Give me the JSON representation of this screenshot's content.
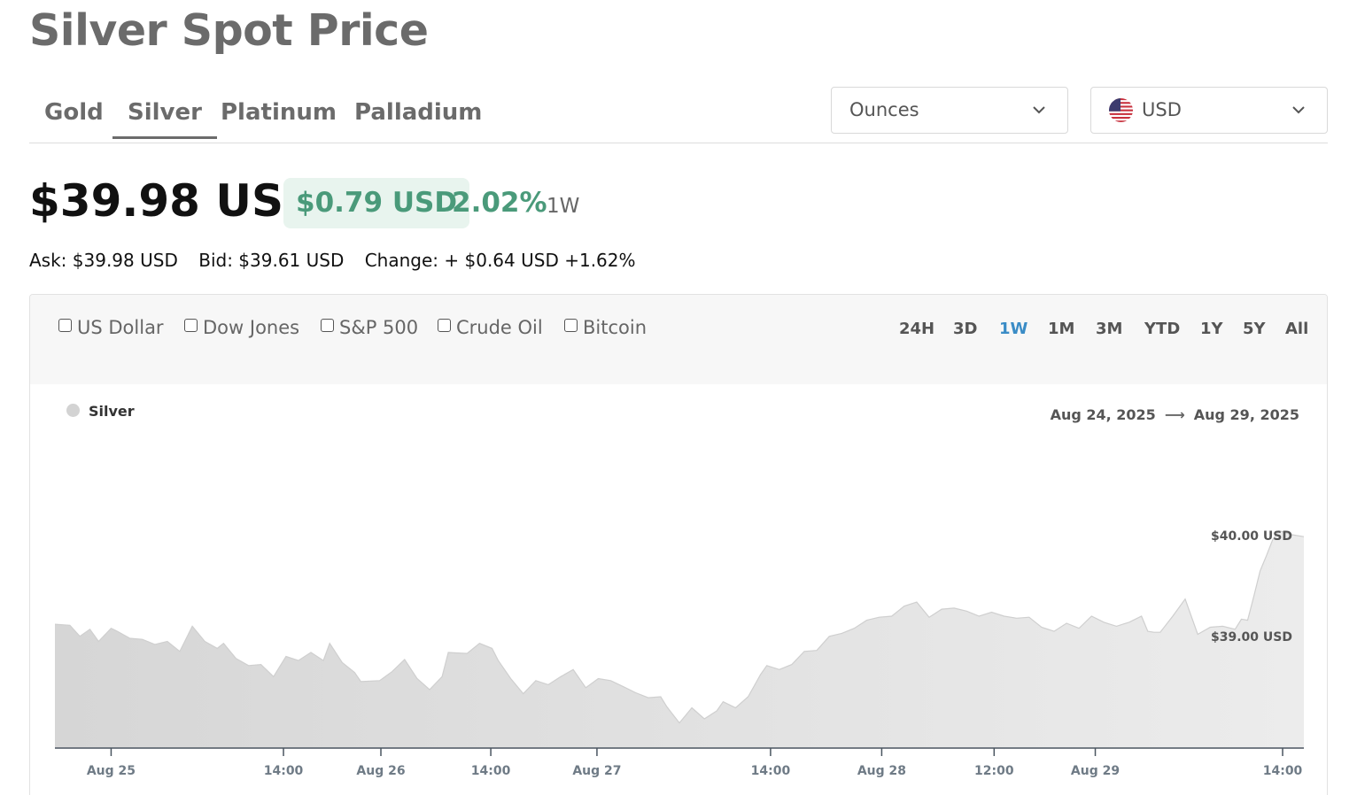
{
  "page_title": "Silver Spot Price",
  "metal_tabs": [
    {
      "label": "Gold",
      "active": false
    },
    {
      "label": "Silver",
      "active": true
    },
    {
      "label": "Platinum",
      "active": false
    },
    {
      "label": "Palladium",
      "active": false
    }
  ],
  "units_select": {
    "value": "Ounces",
    "icon": "chevron-down-icon"
  },
  "currency_select": {
    "value": "USD",
    "icon": "us-flag-icon"
  },
  "price": {
    "current": "$39.98 USD",
    "change": "$0.79 USD",
    "change_pct": "2.02%",
    "period": "1W",
    "change_color": "#4a9a7a"
  },
  "quote": {
    "ask": "Ask: $39.98 USD",
    "bid": "Bid: $39.61 USD",
    "change": "Change: + $0.64 USD +1.62%"
  },
  "compare_options": [
    "US Dollar",
    "Dow Jones",
    "S&P 500",
    "Crude Oil",
    "Bitcoin"
  ],
  "time_ranges": [
    {
      "label": "24H",
      "active": false
    },
    {
      "label": "3D",
      "active": false
    },
    {
      "label": "1W",
      "active": true
    },
    {
      "label": "1M",
      "active": false
    },
    {
      "label": "3M",
      "active": false
    },
    {
      "label": "YTD",
      "active": false
    },
    {
      "label": "1Y",
      "active": false
    },
    {
      "label": "5Y",
      "active": false
    },
    {
      "label": "All",
      "active": false
    }
  ],
  "accent_color": "#3a8cc6",
  "chart_data": {
    "type": "area",
    "legend": "Silver",
    "date_from": "Aug 24, 2025",
    "date_to": "Aug 29, 2025",
    "y_labels": [
      {
        "value": 40.0,
        "label": "$40.00 USD"
      },
      {
        "value": 39.0,
        "label": "$39.00 USD"
      }
    ],
    "x_ticks": [
      {
        "t": 0.045,
        "label": "Aug 25"
      },
      {
        "t": 0.183,
        "label": "14:00"
      },
      {
        "t": 0.261,
        "label": "Aug 26"
      },
      {
        "t": 0.349,
        "label": "14:00"
      },
      {
        "t": 0.434,
        "label": "Aug 27"
      },
      {
        "t": 0.573,
        "label": "14:00"
      },
      {
        "t": 0.662,
        "label": "Aug 28"
      },
      {
        "t": 0.752,
        "label": "12:00"
      },
      {
        "t": 0.833,
        "label": "Aug 29"
      },
      {
        "t": 0.983,
        "label": "14:00"
      }
    ],
    "ylim": [
      37.89,
      40.15
    ],
    "series": [
      {
        "name": "Silver",
        "t": [
          0.0,
          0.012,
          0.02,
          0.028,
          0.035,
          0.045,
          0.05,
          0.06,
          0.07,
          0.08,
          0.09,
          0.1,
          0.11,
          0.12,
          0.13,
          0.135,
          0.145,
          0.155,
          0.165,
          0.175,
          0.185,
          0.195,
          0.205,
          0.215,
          0.22,
          0.23,
          0.24,
          0.245,
          0.26,
          0.27,
          0.28,
          0.29,
          0.3,
          0.31,
          0.315,
          0.33,
          0.34,
          0.35,
          0.355,
          0.365,
          0.375,
          0.385,
          0.395,
          0.405,
          0.415,
          0.425,
          0.435,
          0.445,
          0.455,
          0.465,
          0.475,
          0.485,
          0.49,
          0.5,
          0.51,
          0.52,
          0.53,
          0.535,
          0.545,
          0.555,
          0.565,
          0.57,
          0.58,
          0.59,
          0.6,
          0.61,
          0.62,
          0.63,
          0.64,
          0.65,
          0.66,
          0.67,
          0.68,
          0.69,
          0.7,
          0.71,
          0.72,
          0.73,
          0.74,
          0.75,
          0.76,
          0.77,
          0.78,
          0.79,
          0.8,
          0.81,
          0.82,
          0.83,
          0.84,
          0.85,
          0.86,
          0.87,
          0.875,
          0.88,
          0.885,
          0.895,
          0.905,
          0.915,
          0.925,
          0.935,
          0.945,
          0.95,
          0.955,
          0.96,
          0.965,
          0.97,
          0.975,
          0.98,
          0.985,
          0.99,
          1.0
        ],
        "values": [
          39.12,
          39.11,
          39.0,
          39.07,
          38.95,
          39.08,
          39.05,
          38.98,
          38.97,
          38.92,
          38.95,
          38.85,
          39.1,
          38.95,
          38.88,
          38.93,
          38.78,
          38.71,
          38.72,
          38.6,
          38.8,
          38.76,
          38.84,
          38.76,
          38.93,
          38.74,
          38.64,
          38.55,
          38.56,
          38.65,
          38.77,
          38.58,
          38.47,
          38.6,
          38.84,
          38.83,
          38.93,
          38.88,
          38.76,
          38.58,
          38.43,
          38.56,
          38.52,
          38.6,
          38.67,
          38.49,
          38.58,
          38.56,
          38.5,
          38.44,
          38.39,
          38.4,
          38.3,
          38.14,
          38.29,
          38.18,
          38.26,
          38.35,
          38.29,
          38.4,
          38.62,
          38.71,
          38.67,
          38.72,
          38.85,
          38.86,
          39.0,
          39.03,
          39.08,
          39.16,
          39.19,
          39.2,
          39.3,
          39.34,
          39.19,
          39.27,
          39.28,
          39.25,
          39.2,
          39.24,
          39.2,
          39.18,
          39.19,
          39.09,
          39.05,
          39.13,
          39.08,
          39.2,
          39.14,
          39.1,
          39.14,
          39.2,
          39.05,
          39.04,
          39.04,
          39.2,
          39.37,
          39.02,
          39.09,
          39.1,
          39.07,
          39.17,
          39.16,
          39.4,
          39.65,
          39.8,
          39.96,
          40.05,
          40.03,
          40.01,
          39.99
        ]
      }
    ]
  }
}
